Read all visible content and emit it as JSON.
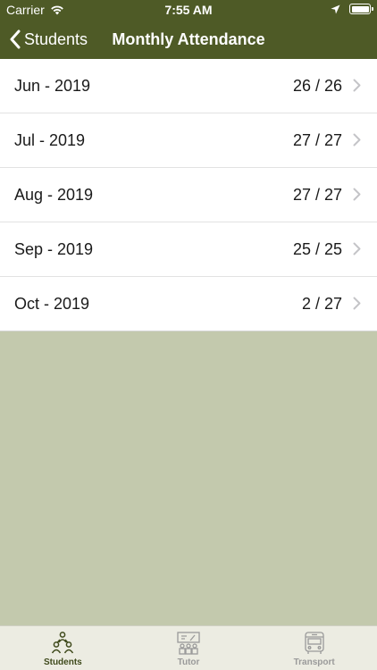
{
  "status_bar": {
    "carrier": "Carrier",
    "time": "7:55 AM",
    "icons": [
      "wifi-icon",
      "location-arrow-icon",
      "battery-icon"
    ]
  },
  "nav": {
    "back_label": "Students",
    "back_icon": "chevron-left-icon",
    "title": "Monthly Attendance"
  },
  "attendance": [
    {
      "month": "Jun - 2019",
      "count": "26 / 26"
    },
    {
      "month": "Jul - 2019",
      "count": "27 / 27"
    },
    {
      "month": "Aug - 2019",
      "count": "27 / 27"
    },
    {
      "month": "Sep - 2019",
      "count": "25 / 25"
    },
    {
      "month": "Oct - 2019",
      "count": "2 / 27"
    }
  ],
  "tabs": [
    {
      "label": "Students",
      "icon": "students-icon",
      "active": true
    },
    {
      "label": "Tutor",
      "icon": "tutor-icon",
      "active": false
    },
    {
      "label": "Transport",
      "icon": "bus-icon",
      "active": false
    }
  ],
  "colors": {
    "header": "#4e5a26",
    "background": "#c3c9ad",
    "tabbar": "#ecece2",
    "active_tab": "#3f4a1c",
    "inactive_tab": "#9a9a9a"
  }
}
